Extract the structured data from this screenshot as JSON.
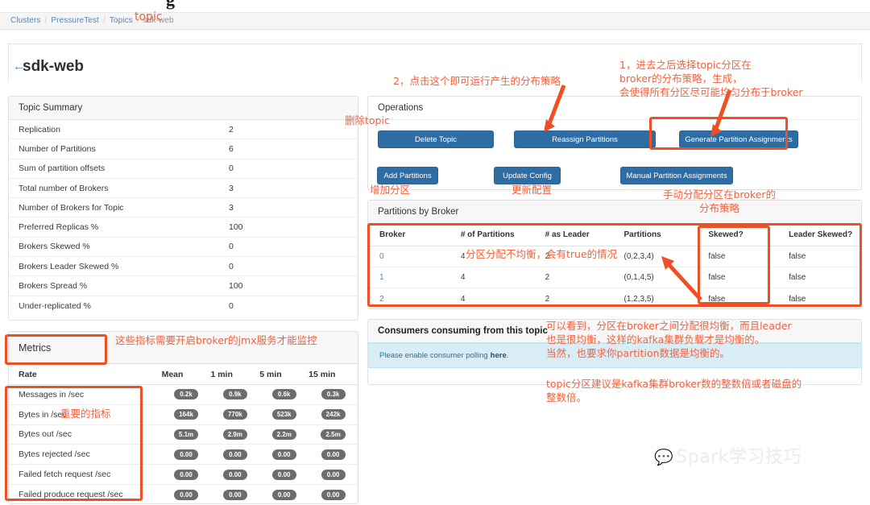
{
  "top_partial_glyph": "g",
  "breadcrumb": {
    "items": [
      "Clusters",
      "PressureTest",
      "Topics"
    ],
    "current": "sdk-web",
    "separator": "/"
  },
  "header": {
    "back_icon": "←",
    "title": "sdk-web"
  },
  "topic_summary": {
    "title": "Topic Summary",
    "rows": [
      {
        "key": "Replication",
        "value": "2"
      },
      {
        "key": "Number of Partitions",
        "value": "6"
      },
      {
        "key": "Sum of partition offsets",
        "value": "0"
      },
      {
        "key": "Total number of Brokers",
        "value": "3"
      },
      {
        "key": "Number of Brokers for Topic",
        "value": "3"
      },
      {
        "key": "Preferred Replicas %",
        "value": "100"
      },
      {
        "key": "Brokers Skewed %",
        "value": "0"
      },
      {
        "key": "Brokers Leader Skewed %",
        "value": "0"
      },
      {
        "key": "Brokers Spread %",
        "value": "100"
      },
      {
        "key": "Under-replicated %",
        "value": "0"
      }
    ]
  },
  "metrics": {
    "title": "Metrics",
    "columns": [
      "Rate",
      "Mean",
      "1 min",
      "5 min",
      "15 min"
    ],
    "rows": [
      {
        "name": "Messages in /sec",
        "mean": "0.2k",
        "m1": "0.9k",
        "m5": "0.6k",
        "m15": "0.3k"
      },
      {
        "name": "Bytes in /sec",
        "mean": "164k",
        "m1": "770k",
        "m5": "523k",
        "m15": "242k"
      },
      {
        "name": "Bytes out /sec",
        "mean": "5.1m",
        "m1": "2.9m",
        "m5": "2.2m",
        "m15": "2.5m"
      },
      {
        "name": "Bytes rejected /sec",
        "mean": "0.00",
        "m1": "0.00",
        "m5": "0.00",
        "m15": "0.00"
      },
      {
        "name": "Failed fetch request /sec",
        "mean": "0.00",
        "m1": "0.00",
        "m5": "0.00",
        "m15": "0.00"
      },
      {
        "name": "Failed produce request /sec",
        "mean": "0.00",
        "m1": "0.00",
        "m5": "0.00",
        "m15": "0.00"
      }
    ]
  },
  "operations": {
    "title": "Operations",
    "delete_topic": "Delete Topic",
    "reassign_partitions": "Reassign Partitions",
    "generate_partition_assignments": "Generate Partition Assignments",
    "add_partitions": "Add Partitions",
    "update_config": "Update Config",
    "manual_partition_assignments": "Manual Partition Assignments"
  },
  "partitions_by_broker": {
    "title": "Partitions by Broker",
    "columns": [
      "Broker",
      "# of Partitions",
      "# as Leader",
      "Partitions",
      "Skewed?",
      "Leader Skewed?"
    ],
    "rows": [
      {
        "broker": "0",
        "num_partitions": "4",
        "num_leader": "2",
        "partitions": "(0,2,3,4)",
        "skewed": "false",
        "leader_skewed": "false"
      },
      {
        "broker": "1",
        "num_partitions": "4",
        "num_leader": "2",
        "partitions": "(0,1,4,5)",
        "skewed": "false",
        "leader_skewed": "false"
      },
      {
        "broker": "2",
        "num_partitions": "4",
        "num_leader": "2",
        "partitions": "(1,2,3,5)",
        "skewed": "false",
        "leader_skewed": "false"
      }
    ]
  },
  "consumers": {
    "title": "Consumers consuming from this topic",
    "alert_text": "Please enable consumer polling",
    "alert_link": "here",
    "alert_suffix": "."
  },
  "annotations": {
    "topic_over_breadcrumb": "topic",
    "step2": "2，点击这个即可运行产生的分布策略",
    "step1_l1": "1，进去之后选择topic分区在",
    "step1_l2": "broker的分布策略，生成，",
    "step1_l3": "会使得所有分区尽可能均匀分布于broker",
    "delete_topic_cn": "删除topic",
    "add_partitions_cn": "增加分区",
    "update_config_cn": "更新配置",
    "manual_assign_l1": "手动分配分区在broker的",
    "manual_assign_l2": "分布策略",
    "metrics_jmx": "这些指标需要开启broker的jmx服务才能监控",
    "important_metrics": "重要的指标",
    "skew_note": "分区分配不均衡，会有true的情况",
    "balance_l1": "可以看到，分区在broker之间分配很均衡，而且leader",
    "balance_l2": "也是很均衡，这样的kafka集群负载才是均衡的。",
    "balance_l3": "当然，也要求你partition数据是均衡的。",
    "advice_l1": "topic分区建议是kafka集群broker数的整数倍或者磁盘的",
    "advice_l2": "整数倍。"
  },
  "watermark": {
    "icon": "wechat-icon",
    "text": "Spark学习技巧"
  },
  "colors": {
    "annotation": "#f4613c",
    "box": "#f04e23",
    "button": "#2e6da4",
    "link": "#4a86c8",
    "badge": "#6c6c6c",
    "alert_bg": "#d9edf7"
  }
}
